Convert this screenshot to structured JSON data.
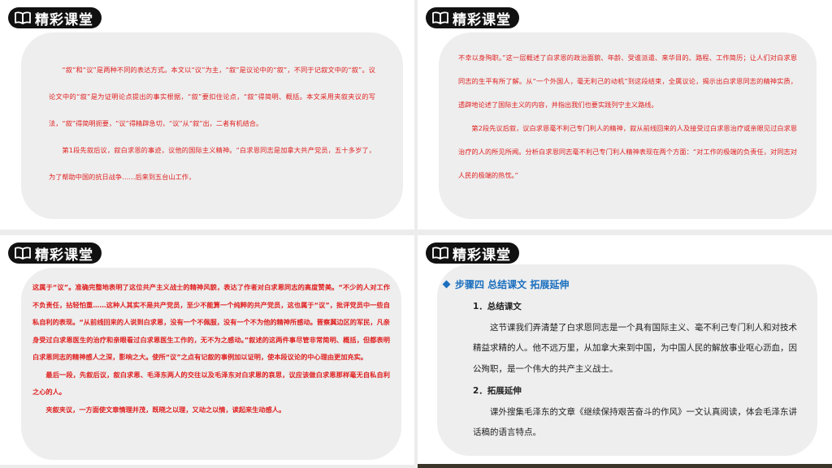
{
  "header_label": "精彩课堂",
  "slide1": {
    "paragraphs": [
      "“叙”和“议”是两种不同的表达方式。本文以“议”为主，“叙”是议论中的“叙”，不同于记叙文中的“叙”。议论文中的“叙”是为证明论点提出的事实根据，“叙”要扣住论点，“叙”得简明、概括。本文采用夹叙夹议的写法，“叙”得简明扼要，“议”得精辟急切，“议”从“叙”出，二者有机结合。",
      "第1段先叙后议，叙白求恩的事迹，议他的国际主义精神。“白求恩同志是加拿大共产党员，五十多岁了，为了帮助中国的抗日战争……后来到五台山工作，"
    ]
  },
  "slide2": {
    "paragraphs": [
      "不幸以身殉职。”这一层概述了白求恩的政治面貌、年龄、受谁派遣、来华目的、路程、工作简历；让人们对白求恩同志的生平有所了解。从“一个外国人，毫无利己的动机”到这段结束，全属议论，揭示出白求恩同志的精神实质，透辟地论述了国际主义的内容，并指出我们也要实践列宁主义路线。",
      "第2段先议后叙，议白求恩毫不利己专门利人的精神，叙从前线回来的人及接受过白求恩治疗或亲眼见过白求恩治疗的人的所见所闻。分析白求恩同志毫不利己专门利人精神表现在两个方面：“对工作的极端的负责任，对同志对人民的极端的热忱。”"
    ]
  },
  "slide3": {
    "paragraphs": [
      "这属于“议”。准确完整地表明了这位共产主义战士的精神风貌，表达了作者对白求恩同志的高度赞美。“不少的人对工作不负责任，拈轻怕重……这种人其实不是共产党员，至少不能算一个纯粹的共产党员，这也属于“议”，批评党员中一些自私自利的表现。“从前线回来的人说到白求恩，没有一个不佩服，没有一个不为他的精神所感动。晋察冀边区的军民，凡亲身受过白求恩医生的治疗和亲眼看过白求恩医生工作的，无不为之感动。”叙述的这两件事尽管非常简明、概括，但都表明白求恩同志的精神感人之深，影响之大。使所“议”之点有记叙的事例加以证明，使本段议论的中心理由更加充实。",
      "最后一段，先叙后议，叙白求恩、毛泽东两人的交往以及毛泽东对白求恩的哀思，议应该做白求恩那样毫无自私自利之心的人。",
      "夹叙夹议，一方面使文章情理并茂，既晓之以理，又动之以情，读起来生动感人。"
    ]
  },
  "slide4": {
    "step_title": "步骤四  总结课文  拓展延伸",
    "sections": [
      {
        "heading": "1．总结课文",
        "body": "这节课我们弄清楚了白求恩同志是一个具有国际主义、毫不利己专门利人和对技术精益求精的人。他不远万里，从加拿大来到中国，为中国人民的解放事业呕心沥血，因公殉职，是一个伟大的共产主义战士。"
      },
      {
        "heading": "2．拓展延伸",
        "body": "课外搜集毛泽东的文章《继续保持艰苦奋斗的作风》一文认真阅读，体会毛泽东讲话稿的语言特点。"
      }
    ]
  },
  "colors": {
    "header_bg": "#111111",
    "body_red": "#e02020",
    "step_blue": "#1a6fbf",
    "card_bg": "#eeeeee"
  },
  "icons": {
    "header": "open-book-icon",
    "step": "diamond-bullet-icon"
  }
}
